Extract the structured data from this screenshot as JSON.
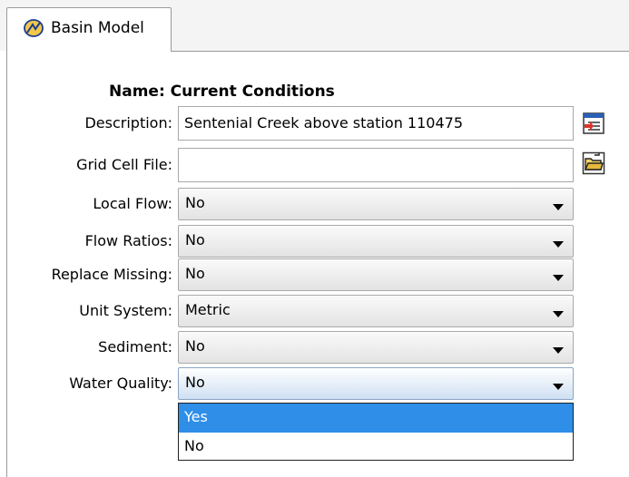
{
  "tab": {
    "label": "Basin Model",
    "icon": "basin-model-icon"
  },
  "name_line": "Name: Current Conditions",
  "fields": {
    "description": {
      "label": "Description:",
      "value": "Sentenial Creek above station 110475"
    },
    "grid_cell_file": {
      "label": "Grid Cell File:",
      "value": ""
    }
  },
  "combos": {
    "local_flow": {
      "label": "Local Flow:",
      "value": "No"
    },
    "flow_ratios": {
      "label": "Flow Ratios:",
      "value": "No"
    },
    "replace_missing": {
      "label": "Replace Missing:",
      "value": "No"
    },
    "unit_system": {
      "label": "Unit System:",
      "value": "Metric"
    },
    "sediment": {
      "label": "Sediment:",
      "value": "No"
    },
    "water_quality": {
      "label": "Water Quality:",
      "value": "No"
    }
  },
  "dropdown_options": [
    "Yes",
    "No"
  ],
  "selected_option": "Yes",
  "colors": {
    "highlight": "#2e8ee8",
    "tab_border": "#9a9a9a"
  }
}
